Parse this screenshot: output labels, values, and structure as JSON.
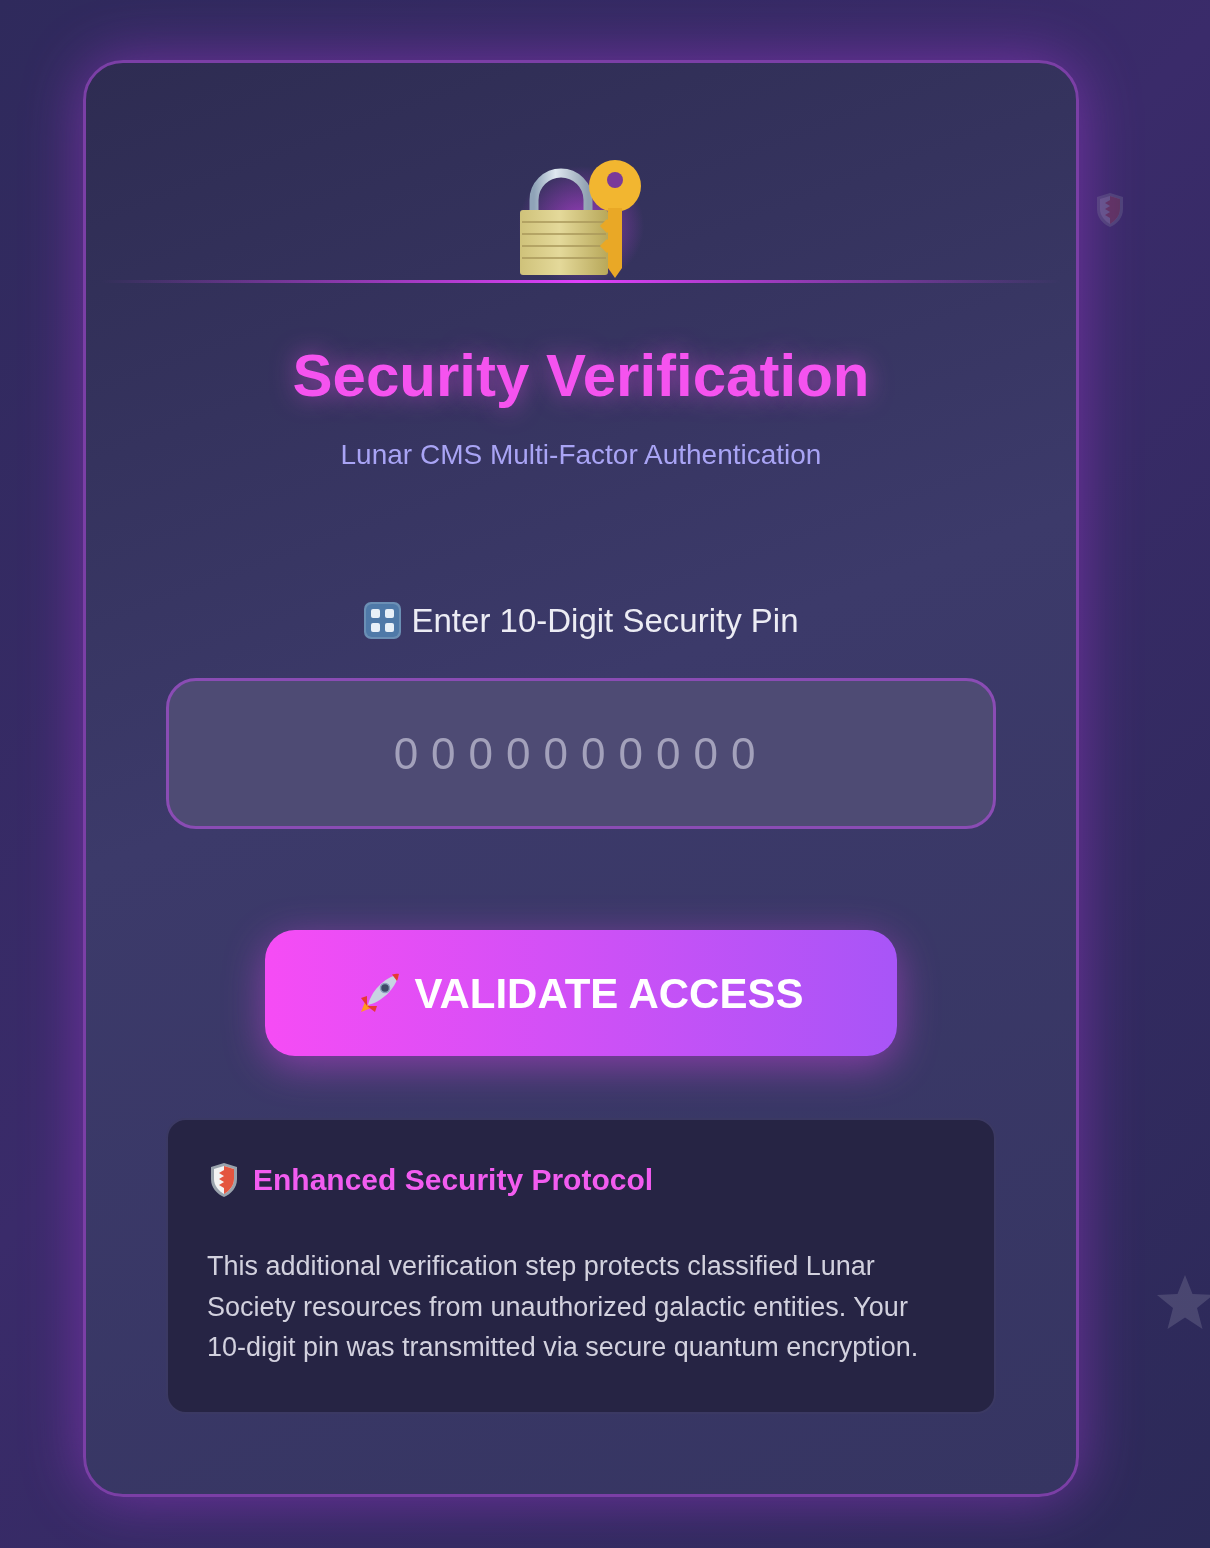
{
  "header": {
    "title": "Security Verification",
    "subtitle": "Lunar CMS Multi-Factor Authentication"
  },
  "pin_field": {
    "label": "Enter 10-Digit Security Pin",
    "placeholder": "0000000000"
  },
  "submit_button": {
    "label": "VALIDATE ACCESS"
  },
  "notice": {
    "title": "Enhanced Security Protocol",
    "text": "This additional verification step protects classified Lunar Society resources from unauthorized galactic entities. Your 10-digit pin was transmitted via secure quantum encryption."
  }
}
